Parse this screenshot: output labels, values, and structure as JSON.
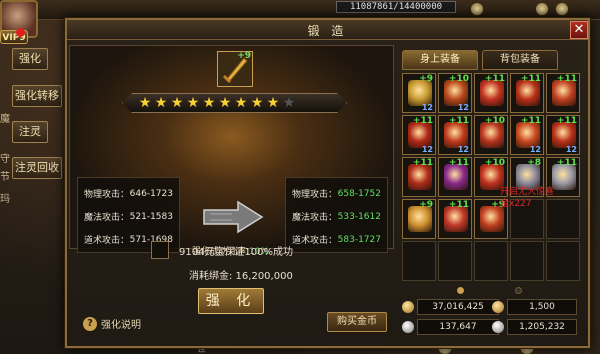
{
  "hud": {
    "hp": "11087861/14400000",
    "vip": "VIP9",
    "side_buttons": [
      "强化",
      "强化转移",
      "注灵",
      "注灵回收"
    ],
    "side_texts": [
      "魔",
      "守",
      "节",
      "玛"
    ],
    "bottom_text": "世"
  },
  "dialog": {
    "title": "锻 造",
    "close_glyph": "✕",
    "item_plus": "+9",
    "stars_total": 10,
    "stars_lit": 9,
    "before": {
      "rows": [
        {
          "label": "物理攻击：",
          "value": "646-1723"
        },
        {
          "label": "魔法攻击：",
          "value": "521-1583"
        },
        {
          "label": "道术攻击：",
          "value": "571-1698"
        }
      ]
    },
    "after": {
      "rows": [
        {
          "label": "物理攻击：",
          "value": "658-1752"
        },
        {
          "label": "魔法攻击：",
          "value": "533-1612"
        },
        {
          "label": "道术攻击：",
          "value": "583-1727"
        }
      ]
    },
    "rate_label": "强化成功几率:",
    "rate_value": "10%",
    "guarantee_text": "9104元宝保证100%成功",
    "cost_text": "消耗绑金: 16,200,000",
    "forge_button": "强 化",
    "help_label": "强化说明",
    "help_glyph": "?",
    "buy_button": "购买金币"
  },
  "equipment": {
    "tabs": [
      "身上装备",
      "背包装备"
    ],
    "active_tab": 0,
    "items": [
      {
        "plus": "+9",
        "count": "12",
        "color": "#c89a30"
      },
      {
        "plus": "+10",
        "count": "12",
        "color": "#b8481c"
      },
      {
        "plus": "+11",
        "count": "",
        "color": "#c03020"
      },
      {
        "plus": "+11",
        "count": "",
        "color": "#b83018"
      },
      {
        "plus": "+11",
        "count": "",
        "color": "#c04020"
      },
      {
        "plus": "+11",
        "count": "12",
        "color": "#b02818"
      },
      {
        "plus": "+11",
        "count": "12",
        "color": "#c03a1c"
      },
      {
        "plus": "+10",
        "count": "",
        "color": "#b83420"
      },
      {
        "plus": "+11",
        "count": "12",
        "color": "#c84820"
      },
      {
        "plus": "+11",
        "count": "12",
        "color": "#b83018"
      },
      {
        "plus": "+11",
        "count": "",
        "color": "#b02c1a"
      },
      {
        "plus": "+11",
        "count": "",
        "color": "#8a2a8a"
      },
      {
        "plus": "+10",
        "count": "",
        "color": "#c03020"
      },
      {
        "plus": "+8",
        "count": "",
        "color": "#8a8a9a"
      },
      {
        "plus": "+11",
        "count": "",
        "color": "#9a9aa8"
      },
      {
        "plus": "+9",
        "count": "",
        "color": "#d09030"
      },
      {
        "plus": "+11",
        "count": "",
        "color": "#c03828"
      },
      {
        "plus": "+9",
        "count": "",
        "color": "#c04020"
      },
      {
        "plus": "",
        "count": "",
        "color": ""
      },
      {
        "plus": "",
        "count": "",
        "color": ""
      },
      {
        "plus": "",
        "count": "",
        "color": ""
      },
      {
        "plus": "",
        "count": "",
        "color": ""
      },
      {
        "plus": "",
        "count": "",
        "color": ""
      },
      {
        "plus": "",
        "count": "",
        "color": ""
      },
      {
        "plus": "",
        "count": "",
        "color": ""
      }
    ],
    "overlay_text": [
      "开启尤大惊喜",
      "金x227"
    ]
  },
  "currency": {
    "gold": "37,016,425",
    "bound_gold": "137,647",
    "yuanbao": "1,500",
    "bound_yuanbao": "1,205,232"
  }
}
